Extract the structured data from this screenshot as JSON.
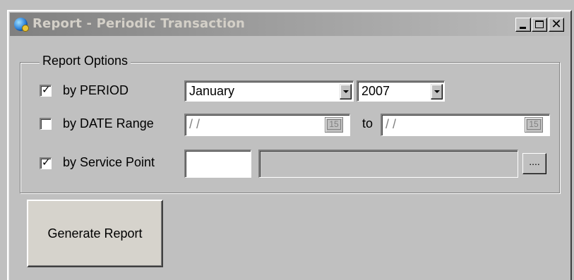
{
  "window": {
    "title": "Report - Periodic Transaction",
    "icon": "globe-app-icon",
    "controls": {
      "minimize": "minimize-icon",
      "maximize": "maximize-icon",
      "close": "✕"
    }
  },
  "report_options": {
    "group_label": "Report Options",
    "by_period": {
      "label": "by PERIOD",
      "checked": true,
      "month_value": "January",
      "year_value": "2007"
    },
    "by_date_range": {
      "label": "by DATE Range",
      "checked": false,
      "from_value": "/ /",
      "to_label": "to",
      "to_value": "/ /",
      "calendar_label": "15"
    },
    "by_service_point": {
      "label": "by Service Point",
      "checked": true,
      "code_value": "",
      "name_value": "",
      "browse_label": "...."
    }
  },
  "actions": {
    "generate_label": "Generate Report"
  }
}
